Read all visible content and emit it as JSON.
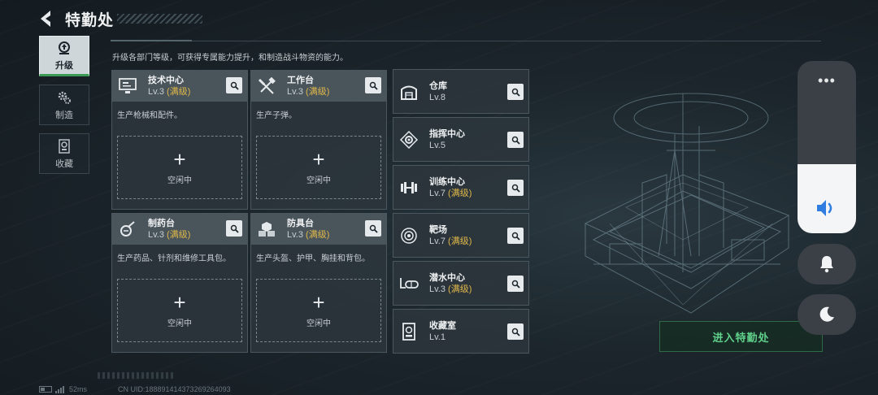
{
  "header": {
    "title": "特勤处"
  },
  "tabs": [
    {
      "label": "升级",
      "icon": "upgrade-icon",
      "active": true
    },
    {
      "label": "制造",
      "icon": "gears-icon",
      "active": false
    },
    {
      "label": "收藏",
      "icon": "collection-icon",
      "active": false
    }
  ],
  "description": "升级各部门等级，可获得专属能力提升，和制造战斗物资的能力。",
  "workshops": [
    {
      "name": "技术中心",
      "level": "Lv.3",
      "max": "(满级)",
      "desc": "生产枪械和配件。",
      "slot_label": "空闲中",
      "icon": "computer-icon"
    },
    {
      "name": "工作台",
      "level": "Lv.3",
      "max": "(满级)",
      "desc": "生产子弹。",
      "slot_label": "空闲中",
      "icon": "tools-icon"
    },
    {
      "name": "制药台",
      "level": "Lv.3",
      "max": "(满级)",
      "desc": "生产药品、针剂和维修工具包。",
      "slot_label": "空闲中",
      "icon": "pharmacy-icon"
    },
    {
      "name": "防具台",
      "level": "Lv.3",
      "max": "(满级)",
      "desc": "生产头盔、护甲、胸挂和背包。",
      "slot_label": "空闲中",
      "icon": "armor-icon"
    }
  ],
  "facilities": [
    {
      "name": "仓库",
      "level": "Lv.8",
      "max": "",
      "icon": "warehouse-icon"
    },
    {
      "name": "指挥中心",
      "level": "Lv.5",
      "max": "",
      "icon": "command-center-icon"
    },
    {
      "name": "训练中心",
      "level": "Lv.7",
      "max": "(满级)",
      "icon": "dumbbell-icon"
    },
    {
      "name": "靶场",
      "level": "Lv.7",
      "max": "(满级)",
      "icon": "target-icon"
    },
    {
      "name": "潜水中心",
      "level": "Lv.3",
      "max": "(满级)",
      "icon": "diving-icon"
    },
    {
      "name": "收藏室",
      "level": "Lv.1",
      "max": "",
      "icon": "collection-room-icon"
    }
  ],
  "enter_button": "进入特勤处",
  "footer": {
    "ping": "52ms",
    "uid": "CN UID:188891414373269264093"
  },
  "system": {
    "more": "•••",
    "volume_fraction": 0.4
  },
  "colors": {
    "accent_green": "#5fd18a",
    "max_gold": "#e0b84a",
    "tab_active": "#cfd6d9"
  }
}
